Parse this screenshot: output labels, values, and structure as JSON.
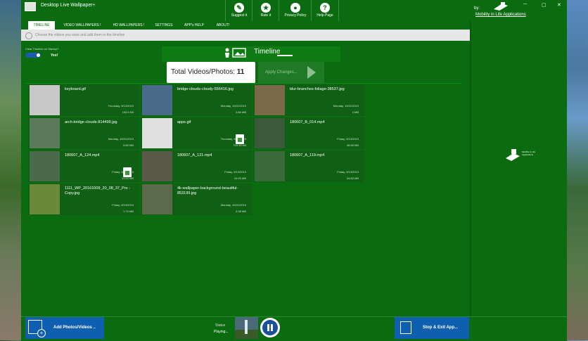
{
  "window": {
    "title": "Desktop Live Wallpaper+",
    "controls": [
      "─",
      "▢",
      "✕"
    ]
  },
  "toolbar": {
    "buttons": [
      {
        "label": "Suggest it",
        "icon": "chat-icon"
      },
      {
        "label": "Rate it",
        "icon": "star-icon"
      },
      {
        "label": "Privacy Policy",
        "icon": "user-icon"
      },
      {
        "label": "Help Page",
        "icon": "question-icon"
      }
    ],
    "by_label": "by:",
    "company_link": "Mobility in Life Applications"
  },
  "tabs": [
    {
      "label": "TIMELINE",
      "active": true
    },
    {
      "label": "VIDEO WALLPAPERS !",
      "active": false
    },
    {
      "label": "HD WALLPAPERS !",
      "active": false
    },
    {
      "label": "SETTINGS",
      "active": false
    },
    {
      "label": "APP's HELP",
      "active": false
    },
    {
      "label": "ABOUT!",
      "active": false
    }
  ],
  "hint": "Choose the videos you want and add them to the timeline",
  "timeline": {
    "clear_label": "Clear Timeline on Startup?",
    "clear_value": "Yes!",
    "title": "Timeline",
    "total_label": "Total Videos/Photos:",
    "total_count": "11",
    "apply_label": "Apply Changes..."
  },
  "items": [
    {
      "name": "keyboard.gif",
      "date": "Thursday, 9/12/2019",
      "size": "193.5 KB",
      "thumb": "#c8c8c8"
    },
    {
      "name": "bridge-clouds-cloudy-556416.jpg",
      "date": "Monday, 10/21/2019",
      "size": "3.86 MB",
      "thumb": "#4a6a8a"
    },
    {
      "name": "blur-branches-foliage-38537.jpg",
      "date": "Monday, 10/21/2019",
      "size": "4 MB",
      "thumb": "#7a6a4a"
    },
    {
      "name": "arch-bridge-clouds-814499.jpg",
      "date": "Monday, 10/21/2019",
      "size": "5.80 MB",
      "thumb": "#5a7a5a"
    },
    {
      "name": "apps.gif",
      "date": "Thursday, 9/12/2019",
      "size": "749.16 KB",
      "thumb": "#e0e0e0"
    },
    {
      "name": "180607_B_014.mp4",
      "date": "Friday, 9/13/2019",
      "size": "46.56 MB",
      "thumb": "#3a5a3a"
    },
    {
      "name": "180607_A_124.mp4",
      "date": "Friday, 9/13/2019",
      "size": "14.54 MB",
      "thumb": "#4a6a4a"
    },
    {
      "name": "180607_A_121.mp4",
      "date": "Friday, 9/13/2019",
      "size": "19.93 MB",
      "thumb": "#5a5a4a"
    },
    {
      "name": "180607_A_119.mp4",
      "date": "Friday, 9/13/2019",
      "size": "34.82 MB",
      "thumb": "#3a6a3a"
    },
    {
      "name": "1111_WP_20161009_20_08_37_Pro - Copy.jpg",
      "date": "Friday, 9/13/2019",
      "size": "1.74 MB",
      "thumb": "#6a8a3a"
    },
    {
      "name": "4k-wallpaper-background-beautiful-853199.jpg",
      "date": "Monday, 10/21/2019",
      "size": "4.38 MB",
      "thumb": "#5a6a4a"
    }
  ],
  "side_logo_text": "Mobility in Life Applications",
  "bottom": {
    "add_label": "Add Photos/Videos ..",
    "status_label": "Status",
    "status_value": "Playing...",
    "stop_label": "Stop & Exit App..."
  },
  "colors": {
    "app_bg": "#0b6b10",
    "accent_blue": "#0f5fb0",
    "active_tab_text": "#0b6b10"
  }
}
